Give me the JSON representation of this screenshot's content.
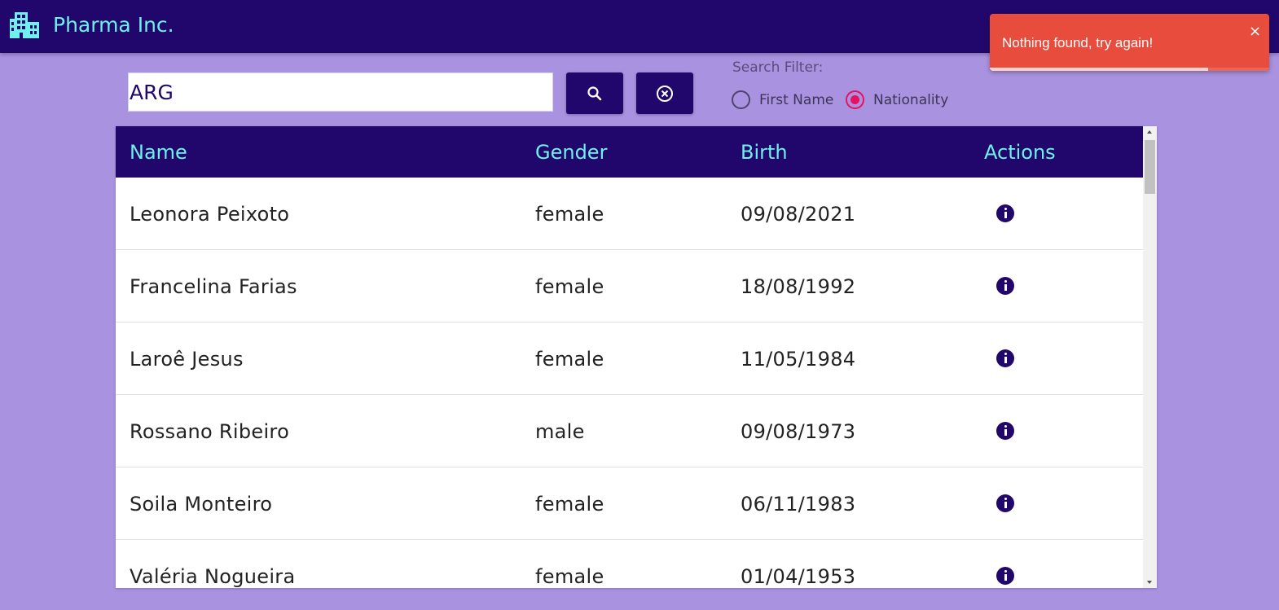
{
  "header": {
    "app_title": "Pharma Inc.",
    "logo_icon": "building-icon",
    "background": "#21076b",
    "accent": "#6ff0ef"
  },
  "search": {
    "value": "ARG",
    "search_button_icon": "search-icon",
    "clear_button_icon": "cancel-circle-icon"
  },
  "filter": {
    "label": "Search Filter:",
    "options": [
      {
        "label": "First Name",
        "selected": false
      },
      {
        "label": "Nationality",
        "selected": true
      }
    ]
  },
  "table": {
    "columns": [
      "Name",
      "Gender",
      "Birth",
      "Actions"
    ],
    "rows": [
      {
        "name": "Leonora Peixoto",
        "gender": "female",
        "birth": "09/08/2021",
        "action_icon": "info-icon"
      },
      {
        "name": "Francelina Farias",
        "gender": "female",
        "birth": "18/08/1992",
        "action_icon": "info-icon"
      },
      {
        "name": "Laroê Jesus",
        "gender": "female",
        "birth": "11/05/1984",
        "action_icon": "info-icon"
      },
      {
        "name": "Rossano Ribeiro",
        "gender": "male",
        "birth": "09/08/1973",
        "action_icon": "info-icon"
      },
      {
        "name": "Soila Monteiro",
        "gender": "female",
        "birth": "06/11/1983",
        "action_icon": "info-icon"
      },
      {
        "name": "Valéria Nogueira",
        "gender": "female",
        "birth": "01/04/1953",
        "action_icon": "info-icon"
      }
    ]
  },
  "toast": {
    "message": "Nothing found, try again!",
    "close_label": "×",
    "color": "#e74c3c",
    "progress": 0.78
  }
}
